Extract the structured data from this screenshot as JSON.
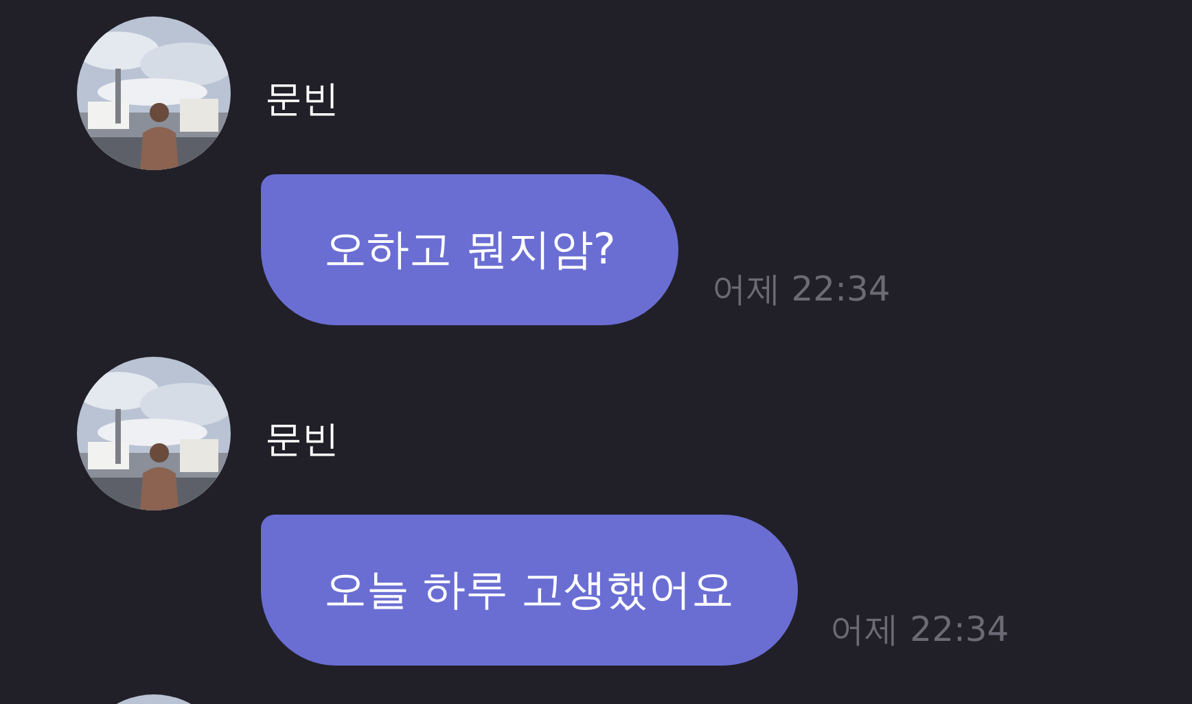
{
  "messages": [
    {
      "sender": "문빈",
      "text": "오하고 뭔지암?",
      "time": "어제 22:34"
    },
    {
      "sender": "문빈",
      "text": "오늘 하루 고생했어요",
      "time": "어제 22:34"
    }
  ]
}
